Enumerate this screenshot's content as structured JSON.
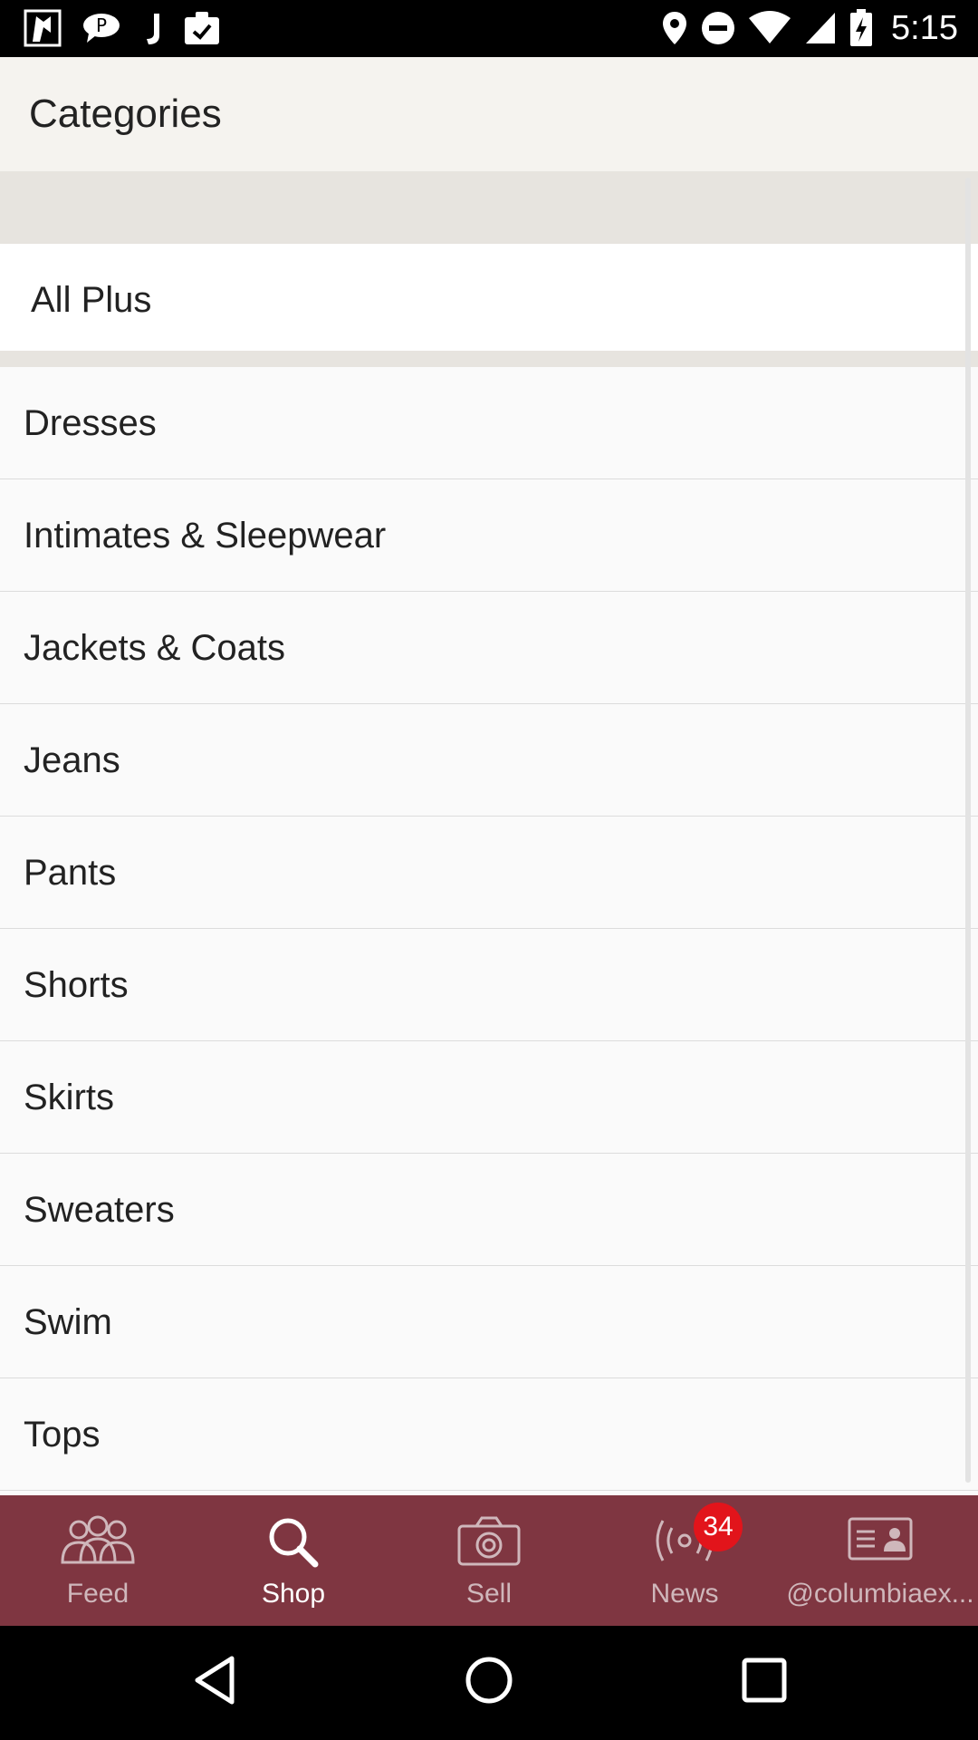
{
  "status_bar": {
    "time": "5:15"
  },
  "app_bar": {
    "title": "Categories"
  },
  "filter": {
    "all_label": "All Plus"
  },
  "categories": [
    "Dresses",
    "Intimates & Sleepwear",
    "Jackets & Coats",
    "Jeans",
    "Pants",
    "Shorts",
    "Skirts",
    "Sweaters",
    "Swim",
    "Tops"
  ],
  "bottom_nav": {
    "items": [
      {
        "label": "Feed",
        "icon": "people-icon"
      },
      {
        "label": "Shop",
        "icon": "search-icon",
        "active": true
      },
      {
        "label": "Sell",
        "icon": "camera-icon"
      },
      {
        "label": "News",
        "icon": "broadcast-icon",
        "badge": "34"
      },
      {
        "label": "@columbiaex...",
        "icon": "profile-card-icon"
      }
    ]
  },
  "colors": {
    "nav_background": "#7f3641",
    "badge": "#e2141b",
    "app_bar": "#f5f3ef"
  }
}
